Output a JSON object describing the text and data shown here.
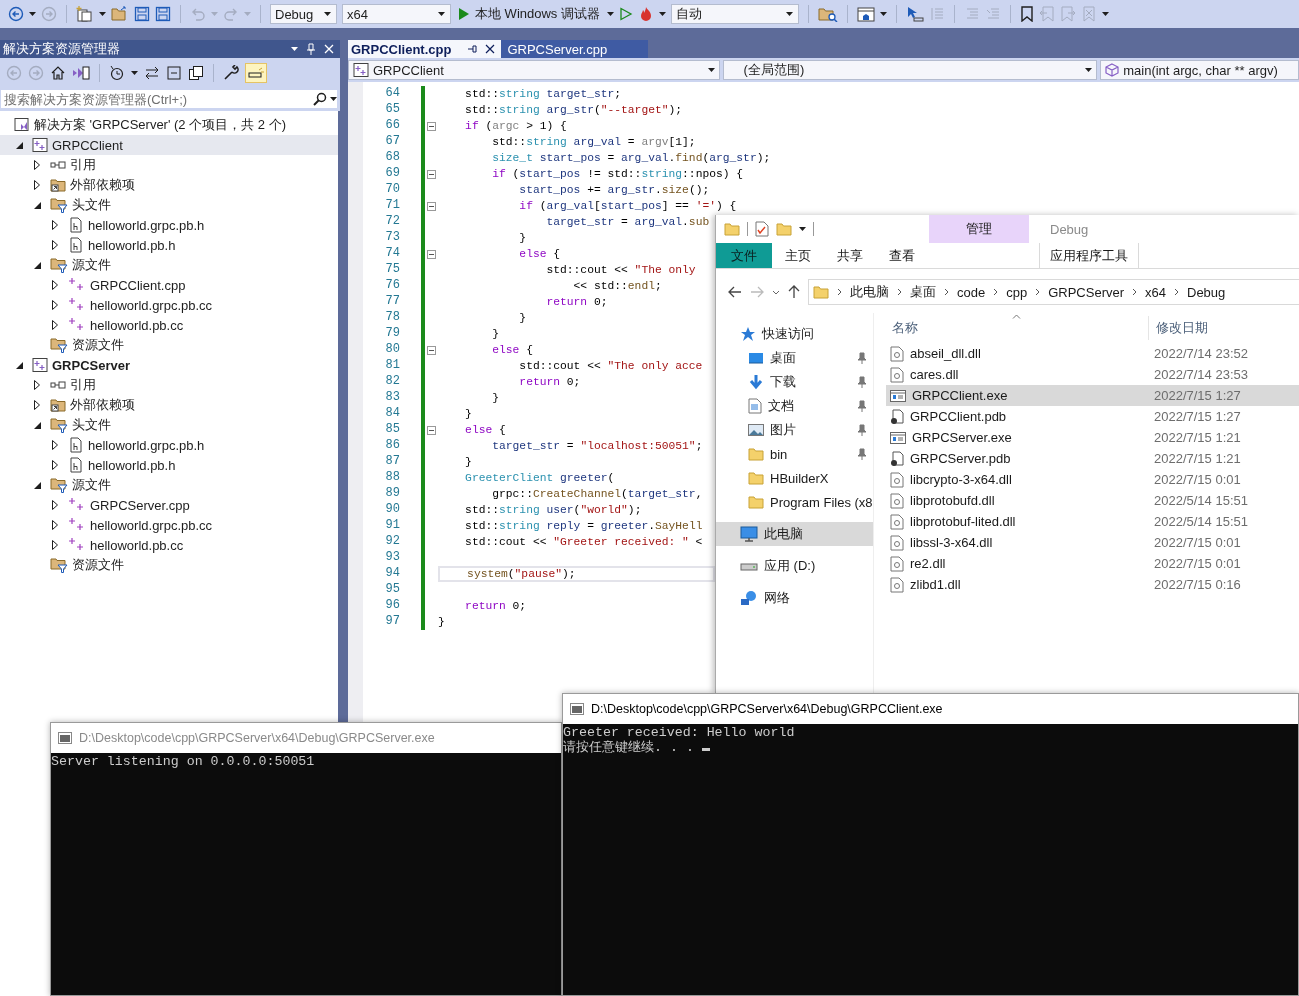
{
  "toolbar": {
    "dropdowns": [
      "Debug",
      "x64",
      "自动"
    ],
    "debugger": "本地 Windows 调试器"
  },
  "solution_explorer": {
    "title": "解决方案资源管理器",
    "search": {
      "placeholder": "搜索解决方案资源管理器(Ctrl+;)"
    },
    "tree": [
      {
        "kind": "solution",
        "label": "解决方案 'GRPCServer' (2 个项目，共 2 个)",
        "selected": false,
        "children": [
          {
            "kind": "project",
            "label": "GRPCClient",
            "selected": true,
            "expanded": true,
            "startup": false,
            "children": [
              {
                "kind": "references",
                "label": "引用",
                "selected": false,
                "expanded": false
              },
              {
                "kind": "external",
                "label": "外部依赖项",
                "selected": false,
                "expanded": false
              },
              {
                "kind": "filter",
                "label": "头文件",
                "selected": false,
                "expanded": true,
                "children": [
                  {
                    "kind": "header",
                    "label": "helloworld.grpc.pb.h",
                    "selected": false,
                    "expanded": false
                  },
                  {
                    "kind": "header",
                    "label": "helloworld.pb.h",
                    "selected": false,
                    "expanded": false
                  }
                ]
              },
              {
                "kind": "filter",
                "label": "源文件",
                "selected": false,
                "expanded": true,
                "children": [
                  {
                    "kind": "source",
                    "label": "GRPCClient.cpp",
                    "selected": false,
                    "expanded": false
                  },
                  {
                    "kind": "source",
                    "label": "helloworld.grpc.pb.cc",
                    "selected": false,
                    "expanded": false
                  },
                  {
                    "kind": "source",
                    "label": "helloworld.pb.cc",
                    "selected": false,
                    "expanded": false
                  }
                ]
              },
              {
                "kind": "filter",
                "label": "资源文件",
                "selected": false
              }
            ]
          },
          {
            "kind": "project",
            "label": "GRPCServer",
            "selected": false,
            "expanded": true,
            "startup": true,
            "children": [
              {
                "kind": "references",
                "label": "引用",
                "selected": false,
                "expanded": false
              },
              {
                "kind": "external",
                "label": "外部依赖项",
                "selected": false,
                "expanded": false
              },
              {
                "kind": "filter",
                "label": "头文件",
                "selected": false,
                "expanded": true,
                "children": [
                  {
                    "kind": "header",
                    "label": "helloworld.grpc.pb.h",
                    "selected": false,
                    "expanded": false
                  },
                  {
                    "kind": "header",
                    "label": "helloworld.pb.h",
                    "selected": false,
                    "expanded": false
                  }
                ]
              },
              {
                "kind": "filter",
                "label": "源文件",
                "selected": false,
                "expanded": true,
                "children": [
                  {
                    "kind": "source",
                    "label": "GRPCServer.cpp",
                    "selected": false,
                    "expanded": false
                  },
                  {
                    "kind": "source",
                    "label": "helloworld.grpc.pb.cc",
                    "selected": false,
                    "expanded": false
                  },
                  {
                    "kind": "source",
                    "label": "helloworld.pb.cc",
                    "selected": false,
                    "expanded": false
                  }
                ]
              },
              {
                "kind": "filter",
                "label": "资源文件",
                "selected": false
              }
            ]
          }
        ]
      }
    ]
  },
  "editor": {
    "tabs": [
      {
        "label": "GRPCClient.cpp",
        "selected": true
      },
      {
        "label": "GRPCServer.cpp",
        "selected": false
      }
    ],
    "navigation": [
      "GRPCClient",
      "(全局范围)",
      "main(int argc, char ** argv)"
    ],
    "lines": [
      {
        "number": "64",
        "fold": false,
        "current": false,
        "tokens": [
          {
            "kind": "plain",
            "text": "    std::"
          },
          {
            "kind": "type",
            "text": "string"
          },
          {
            "kind": "variable",
            "text": " target_str"
          },
          {
            "kind": "plain",
            "text": ";"
          }
        ]
      },
      {
        "number": "65",
        "fold": false,
        "current": false,
        "tokens": [
          {
            "kind": "plain",
            "text": "    std::"
          },
          {
            "kind": "type",
            "text": "string"
          },
          {
            "kind": "variable",
            "text": " arg_str"
          },
          {
            "kind": "plain",
            "text": "("
          },
          {
            "kind": "string",
            "text": "\"--target\""
          },
          {
            "kind": "plain",
            "text": ");"
          }
        ]
      },
      {
        "number": "66",
        "fold": true,
        "current": false,
        "tokens": [
          {
            "kind": "keyword",
            "text": "    if"
          },
          {
            "kind": "plain",
            "text": " ("
          },
          {
            "kind": "parameter",
            "text": "argc"
          },
          {
            "kind": "plain",
            "text": " > 1) {"
          }
        ]
      },
      {
        "number": "67",
        "fold": false,
        "current": false,
        "tokens": [
          {
            "kind": "plain",
            "text": "        std::"
          },
          {
            "kind": "type",
            "text": "string"
          },
          {
            "kind": "variable",
            "text": " arg_val"
          },
          {
            "kind": "plain",
            "text": " = "
          },
          {
            "kind": "parameter",
            "text": "argv"
          },
          {
            "kind": "plain",
            "text": "[1];"
          }
        ]
      },
      {
        "number": "68",
        "fold": false,
        "current": false,
        "tokens": [
          {
            "kind": "type",
            "text": "        size_t"
          },
          {
            "kind": "variable",
            "text": " start_pos"
          },
          {
            "kind": "plain",
            "text": " = "
          },
          {
            "kind": "variable",
            "text": "arg_val"
          },
          {
            "kind": "plain",
            "text": "."
          },
          {
            "kind": "function",
            "text": "find"
          },
          {
            "kind": "plain",
            "text": "("
          },
          {
            "kind": "variable",
            "text": "arg_str"
          },
          {
            "kind": "plain",
            "text": ");"
          }
        ]
      },
      {
        "number": "69",
        "fold": true,
        "current": false,
        "tokens": [
          {
            "kind": "keyword",
            "text": "        if"
          },
          {
            "kind": "plain",
            "text": " ("
          },
          {
            "kind": "variable",
            "text": "start_pos"
          },
          {
            "kind": "plain",
            "text": " != std::"
          },
          {
            "kind": "type",
            "text": "string"
          },
          {
            "kind": "plain",
            "text": "::npos) {"
          }
        ]
      },
      {
        "number": "70",
        "fold": false,
        "current": false,
        "tokens": [
          {
            "kind": "variable",
            "text": "            start_pos"
          },
          {
            "kind": "plain",
            "text": " += "
          },
          {
            "kind": "variable",
            "text": "arg_str"
          },
          {
            "kind": "plain",
            "text": "."
          },
          {
            "kind": "function",
            "text": "size"
          },
          {
            "kind": "plain",
            "text": "();"
          }
        ]
      },
      {
        "number": "71",
        "fold": true,
        "current": false,
        "tokens": [
          {
            "kind": "keyword",
            "text": "            if"
          },
          {
            "kind": "plain",
            "text": " ("
          },
          {
            "kind": "variable",
            "text": "arg_val"
          },
          {
            "kind": "plain",
            "text": "["
          },
          {
            "kind": "variable",
            "text": "start_pos"
          },
          {
            "kind": "plain",
            "text": "] == "
          },
          {
            "kind": "string",
            "text": "'='"
          },
          {
            "kind": "plain",
            "text": ") {"
          }
        ]
      },
      {
        "number": "72",
        "fold": false,
        "current": false,
        "tokens": [
          {
            "kind": "variable",
            "text": "                target_str"
          },
          {
            "kind": "plain",
            "text": " = "
          },
          {
            "kind": "variable",
            "text": "arg_val"
          },
          {
            "kind": "plain",
            "text": "."
          },
          {
            "kind": "function",
            "text": "sub"
          }
        ]
      },
      {
        "number": "73",
        "fold": false,
        "current": false,
        "tokens": [
          {
            "kind": "plain",
            "text": "            }"
          }
        ]
      },
      {
        "number": "74",
        "fold": true,
        "current": false,
        "tokens": [
          {
            "kind": "keyword",
            "text": "            else"
          },
          {
            "kind": "plain",
            "text": " {"
          }
        ]
      },
      {
        "number": "75",
        "fold": false,
        "current": false,
        "tokens": [
          {
            "kind": "plain",
            "text": "                std::cout << "
          },
          {
            "kind": "string",
            "text": "\"The only"
          }
        ]
      },
      {
        "number": "76",
        "fold": false,
        "current": false,
        "tokens": [
          {
            "kind": "plain",
            "text": "                    << std::"
          },
          {
            "kind": "function",
            "text": "endl"
          },
          {
            "kind": "plain",
            "text": ";"
          }
        ]
      },
      {
        "number": "77",
        "fold": false,
        "current": false,
        "tokens": [
          {
            "kind": "keyword",
            "text": "                return"
          },
          {
            "kind": "plain",
            "text": " 0;"
          }
        ]
      },
      {
        "number": "78",
        "fold": false,
        "current": false,
        "tokens": [
          {
            "kind": "plain",
            "text": "            }"
          }
        ]
      },
      {
        "number": "79",
        "fold": false,
        "current": false,
        "tokens": [
          {
            "kind": "plain",
            "text": "        }"
          }
        ]
      },
      {
        "number": "80",
        "fold": true,
        "current": false,
        "tokens": [
          {
            "kind": "keyword",
            "text": "        else"
          },
          {
            "kind": "plain",
            "text": " {"
          }
        ]
      },
      {
        "number": "81",
        "fold": false,
        "current": false,
        "tokens": [
          {
            "kind": "plain",
            "text": "            std::cout << "
          },
          {
            "kind": "string",
            "text": "\"The only acce"
          }
        ]
      },
      {
        "number": "82",
        "fold": false,
        "current": false,
        "tokens": [
          {
            "kind": "keyword",
            "text": "            return"
          },
          {
            "kind": "plain",
            "text": " 0;"
          }
        ]
      },
      {
        "number": "83",
        "fold": false,
        "current": false,
        "tokens": [
          {
            "kind": "plain",
            "text": "        }"
          }
        ]
      },
      {
        "number": "84",
        "fold": false,
        "current": false,
        "tokens": [
          {
            "kind": "plain",
            "text": "    }"
          }
        ]
      },
      {
        "number": "85",
        "fold": true,
        "current": false,
        "tokens": [
          {
            "kind": "keyword",
            "text": "    else"
          },
          {
            "kind": "plain",
            "text": " {"
          }
        ]
      },
      {
        "number": "86",
        "fold": false,
        "current": false,
        "tokens": [
          {
            "kind": "variable",
            "text": "        target_str"
          },
          {
            "kind": "plain",
            "text": " = "
          },
          {
            "kind": "string",
            "text": "\"localhost:50051\""
          },
          {
            "kind": "plain",
            "text": ";"
          }
        ]
      },
      {
        "number": "87",
        "fold": false,
        "current": false,
        "tokens": [
          {
            "kind": "plain",
            "text": "    }"
          }
        ]
      },
      {
        "number": "88",
        "fold": false,
        "current": false,
        "tokens": [
          {
            "kind": "type",
            "text": "    GreeterClient"
          },
          {
            "kind": "variable",
            "text": " greeter"
          },
          {
            "kind": "plain",
            "text": "("
          }
        ]
      },
      {
        "number": "89",
        "fold": false,
        "current": false,
        "tokens": [
          {
            "kind": "plain",
            "text": "        grpc::"
          },
          {
            "kind": "function",
            "text": "CreateChannel"
          },
          {
            "kind": "plain",
            "text": "("
          },
          {
            "kind": "variable",
            "text": "target_str"
          },
          {
            "kind": "plain",
            "text": ","
          }
        ]
      },
      {
        "number": "90",
        "fold": false,
        "current": false,
        "tokens": [
          {
            "kind": "plain",
            "text": "    std::"
          },
          {
            "kind": "type",
            "text": "string"
          },
          {
            "kind": "variable",
            "text": " user"
          },
          {
            "kind": "plain",
            "text": "("
          },
          {
            "kind": "string",
            "text": "\"world\""
          },
          {
            "kind": "plain",
            "text": ");"
          }
        ]
      },
      {
        "number": "91",
        "fold": false,
        "current": false,
        "tokens": [
          {
            "kind": "plain",
            "text": "    std::"
          },
          {
            "kind": "type",
            "text": "string"
          },
          {
            "kind": "variable",
            "text": " reply"
          },
          {
            "kind": "plain",
            "text": " = "
          },
          {
            "kind": "variable",
            "text": "greeter"
          },
          {
            "kind": "plain",
            "text": "."
          },
          {
            "kind": "function",
            "text": "SayHell"
          }
        ]
      },
      {
        "number": "92",
        "fold": false,
        "current": false,
        "tokens": [
          {
            "kind": "plain",
            "text": "    std::cout << "
          },
          {
            "kind": "string",
            "text": "\"Greeter received: \""
          },
          {
            "kind": "plain",
            "text": " <"
          }
        ]
      },
      {
        "number": "93",
        "fold": false,
        "current": false
      },
      {
        "number": "94",
        "fold": false,
        "current": true,
        "tokens": [
          {
            "kind": "function",
            "text": "    system"
          },
          {
            "kind": "plain",
            "text": "("
          },
          {
            "kind": "string",
            "text": "\"pause\""
          },
          {
            "kind": "plain",
            "text": ");"
          }
        ]
      },
      {
        "number": "95",
        "fold": false,
        "current": false
      },
      {
        "number": "96",
        "fold": false,
        "current": false,
        "tokens": [
          {
            "kind": "keyword",
            "text": "    return"
          },
          {
            "kind": "plain",
            "text": " 0;"
          }
        ]
      },
      {
        "number": "97",
        "fold": false,
        "current": false,
        "tokens": [
          {
            "kind": "plain",
            "text": "}"
          }
        ]
      }
    ]
  },
  "file_explorer": {
    "title": "Debug",
    "contextual_tab": "管理",
    "ribbon_tabs": [
      {
        "kind": "menu",
        "label": "文件"
      },
      {
        "kind": "tab",
        "label": "主页"
      },
      {
        "kind": "tab",
        "label": "共享"
      },
      {
        "kind": "tab",
        "label": "查看"
      },
      {
        "kind": "contextual",
        "label": "应用程序工具"
      }
    ],
    "path": [
      "此电脑",
      "桌面",
      "code",
      "cpp",
      "GRPCServer",
      "x64",
      "Debug"
    ],
    "navigation": [
      {
        "kind": "quick",
        "label": "快速访问",
        "pinned": false,
        "selected": false,
        "children": [
          {
            "kind": "desktop",
            "label": "桌面",
            "pinned": true,
            "selected": false
          },
          {
            "kind": "downloads",
            "label": "下载",
            "pinned": true,
            "selected": false
          },
          {
            "kind": "documents",
            "label": "文档",
            "pinned": true,
            "selected": false
          },
          {
            "kind": "pictures",
            "label": "图片",
            "pinned": true,
            "selected": false
          },
          {
            "kind": "folder",
            "label": "bin",
            "pinned": true,
            "selected": false
          },
          {
            "kind": "folder",
            "label": "HBuilderX",
            "pinned": false,
            "selected": false
          },
          {
            "kind": "folder",
            "label": "Program Files (x8",
            "selected": false
          }
        ]
      },
      {
        "kind": "pc",
        "label": "此电脑",
        "pinned": false,
        "selected": true
      },
      {
        "kind": "drive",
        "label": "应用 (D:)",
        "pinned": false,
        "selected": false
      },
      {
        "kind": "network",
        "label": "网络",
        "pinned": false,
        "selected": false
      }
    ],
    "columns": [
      "名称",
      "修改日期"
    ],
    "files": [
      {
        "kind": "dll",
        "name": "abseil_dll.dll",
        "modified": "2022/7/14 23:52",
        "selected": false
      },
      {
        "kind": "dll",
        "name": "cares.dll",
        "modified": "2022/7/14 23:53",
        "selected": false
      },
      {
        "kind": "exe",
        "name": "GRPCClient.exe",
        "modified": "2022/7/15 1:27",
        "selected": true
      },
      {
        "kind": "pdb",
        "name": "GRPCClient.pdb",
        "modified": "2022/7/15 1:27",
        "selected": false
      },
      {
        "kind": "exe",
        "name": "GRPCServer.exe",
        "modified": "2022/7/15 1:21",
        "selected": false
      },
      {
        "kind": "pdb",
        "name": "GRPCServer.pdb",
        "modified": "2022/7/15 1:21",
        "selected": false
      },
      {
        "kind": "dll",
        "name": "libcrypto-3-x64.dll",
        "modified": "2022/7/15 0:01",
        "selected": false
      },
      {
        "kind": "dll",
        "name": "libprotobufd.dll",
        "modified": "2022/5/14 15:51",
        "selected": false
      },
      {
        "kind": "dll",
        "name": "libprotobuf-lited.dll",
        "modified": "2022/5/14 15:51",
        "selected": false
      },
      {
        "kind": "dll",
        "name": "libssl-3-x64.dll",
        "modified": "2022/7/15 0:01",
        "selected": false
      },
      {
        "kind": "dll",
        "name": "re2.dll",
        "modified": "2022/7/15 0:01",
        "selected": false
      },
      {
        "kind": "dll",
        "name": "zlibd1.dll",
        "modified": "2022/7/15 0:16",
        "selected": false
      }
    ]
  },
  "consoles": [
    {
      "title": "D:\\Desktop\\code\\cpp\\GRPCServer\\x64\\Debug\\GRPCServer.exe",
      "active": false,
      "cursor": false,
      "lines": [
        "Server listening on 0.0.0.0:50051"
      ]
    },
    {
      "title": "D:\\Desktop\\code\\cpp\\GRPCServer\\x64\\Debug\\GRPCClient.exe",
      "active": true,
      "cursor": true,
      "lines": [
        "Greeter received: Hello world",
        "请按任意键继续. . ."
      ]
    }
  ]
}
